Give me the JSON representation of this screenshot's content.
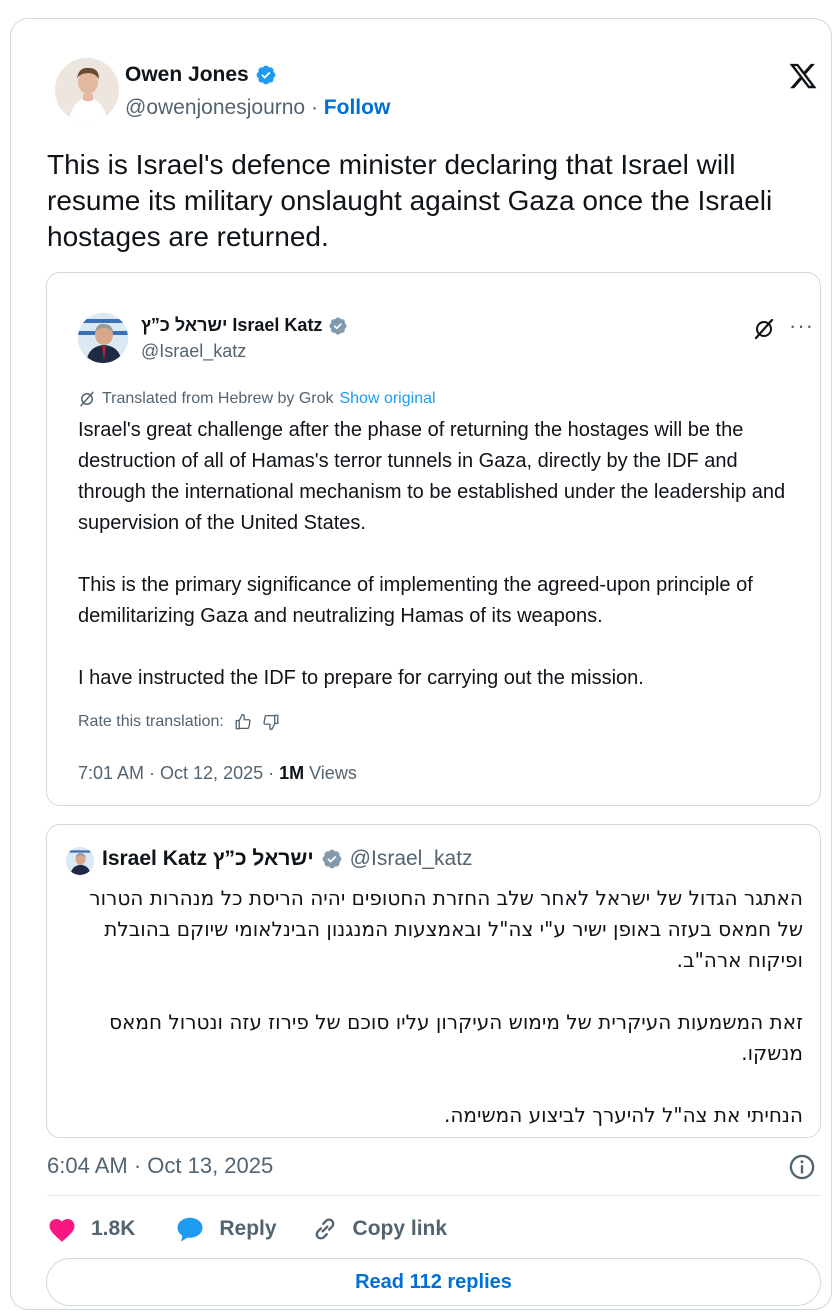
{
  "author": {
    "name": "Owen Jones",
    "handle": "@owenjonesjourno",
    "separator": "·",
    "follow_label": "Follow"
  },
  "tweet": {
    "text": "This is Israel's defence minister declaring that Israel will resume its military onslaught against Gaza once the Israeli hostages are returned.",
    "timestamp": "6:04 AM · Oct 13, 2025"
  },
  "quoted_tweet": {
    "name": "ישראל כ”ץ Israel Katz",
    "handle": "@Israel_katz",
    "more_label": "···",
    "translated_label": "Translated from Hebrew by Grok",
    "show_original_label": "Show original",
    "paragraphs": [
      "Israel's great challenge after the phase of returning the hostages will be the destruction of all of Hamas's terror tunnels in Gaza, directly by the IDF and through the international mechanism to be established under the leadership and supervision of the United States.",
      "This is the primary significance of implementing the agreed-upon principle of demilitarizing Gaza and neutralizing Hamas of its weapons.",
      "I have instructed the IDF to prepare for carrying out the mission."
    ],
    "rate_label": "Rate this translation:",
    "time": "7:01 AM · Oct 12, 2025 · ",
    "views_count": "1M",
    "views_label": " Views"
  },
  "original_tweet": {
    "name": "Israel Katz ישראל כ”ץ",
    "handle": "@Israel_katz",
    "paragraphs": [
      "האתגר הגדול של ישראל לאחר שלב החזרת החטופים יהיה הריסת כל מנהרות הטרור של חמאס בעזה באופן ישיר ע\"י צה\"ל ובאמצעות המנגנון הבינלאומי שיוקם בהובלת ופיקוח ארה\"ב.",
      "זאת המשמעות העיקרית של מימוש העיקרון עליו סוכם של פירוז עזה ונטרול חמאס מנשקו.",
      "הנחיתי את צה\"ל להיערך לביצוע המשימה."
    ]
  },
  "actions": {
    "likes": "1.8K",
    "reply_label": "Reply",
    "copy_label": "Copy link"
  },
  "read_replies_label": "Read 112 replies",
  "colors": {
    "link_blue": "#006fd6",
    "verified_blue": "#1d9bf0",
    "heart": "#f91880",
    "secondary_text": "#536471"
  }
}
